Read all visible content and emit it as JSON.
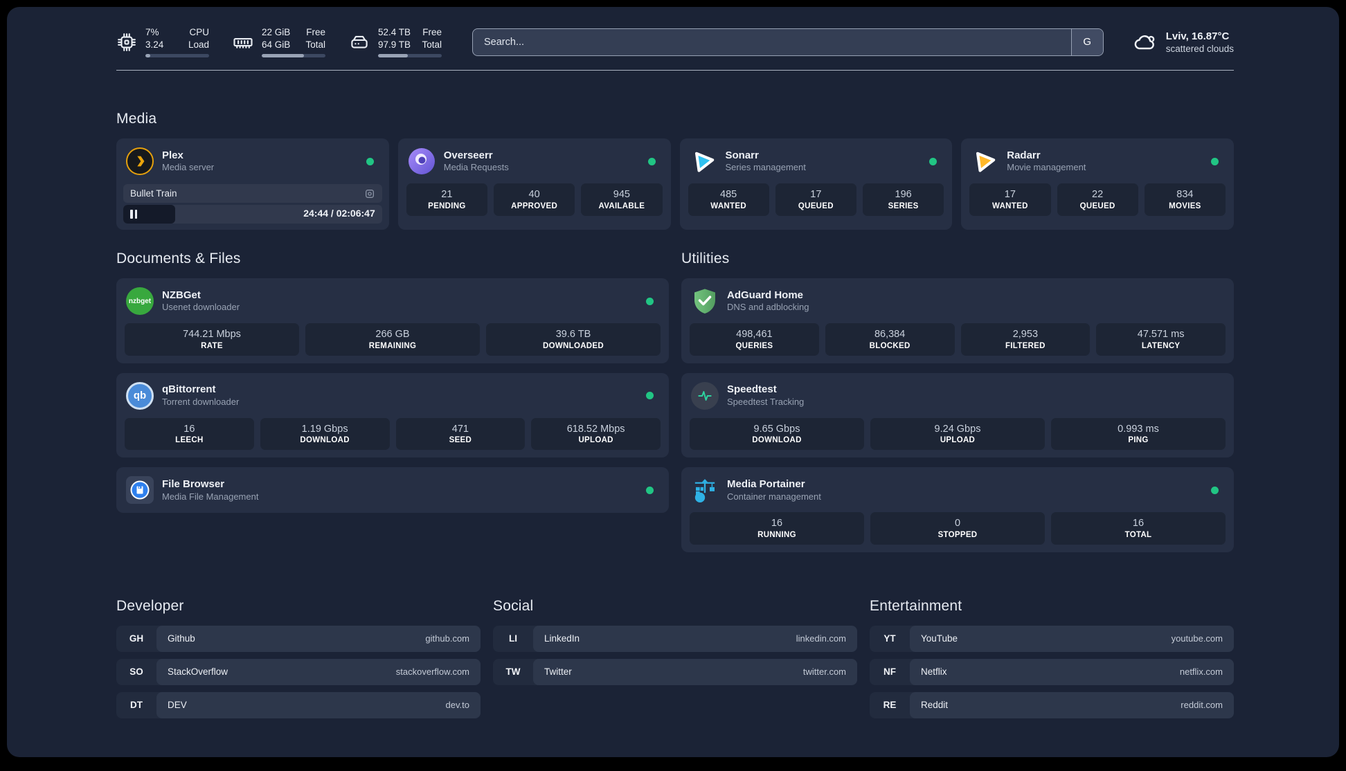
{
  "header": {
    "widgets": [
      {
        "name": "cpu",
        "value_top": "7%",
        "value_bottom": "3.24",
        "label_top": "CPU",
        "label_bottom": "Load",
        "progress_pct": 8
      },
      {
        "name": "memory",
        "value_top": "22 GiB",
        "value_bottom": "64 GiB",
        "label_top": "Free",
        "label_bottom": "Total",
        "progress_pct": 66
      },
      {
        "name": "disk",
        "value_top": "52.4 TB",
        "value_bottom": "97.9 TB",
        "label_top": "Free",
        "label_bottom": "Total",
        "progress_pct": 47
      }
    ],
    "search": {
      "placeholder": "Search...",
      "button_label": "G"
    },
    "weather": {
      "title": "Lviv, 16.87°C",
      "subtitle": "scattered clouds"
    }
  },
  "sections": {
    "media": {
      "title": "Media",
      "services": [
        {
          "name": "Plex",
          "description": "Media server",
          "status": "online",
          "player": {
            "track": "Bullet Train",
            "time": "24:44 / 02:06:47",
            "progress_pct": 20
          }
        },
        {
          "name": "Overseerr",
          "description": "Media Requests",
          "status": "online",
          "stats": [
            {
              "value": "21",
              "label": "PENDING"
            },
            {
              "value": "40",
              "label": "APPROVED"
            },
            {
              "value": "945",
              "label": "AVAILABLE"
            }
          ]
        },
        {
          "name": "Sonarr",
          "description": "Series management",
          "status": "online",
          "stats": [
            {
              "value": "485",
              "label": "WANTED"
            },
            {
              "value": "17",
              "label": "QUEUED"
            },
            {
              "value": "196",
              "label": "SERIES"
            }
          ]
        },
        {
          "name": "Radarr",
          "description": "Movie management",
          "status": "online",
          "stats": [
            {
              "value": "17",
              "label": "WANTED"
            },
            {
              "value": "22",
              "label": "QUEUED"
            },
            {
              "value": "834",
              "label": "MOVIES"
            }
          ]
        }
      ]
    },
    "documents": {
      "title": "Documents & Files",
      "services": [
        {
          "name": "NZBGet",
          "description": "Usenet downloader",
          "status": "online",
          "stats": [
            {
              "value": "744.21 Mbps",
              "label": "RATE"
            },
            {
              "value": "266 GB",
              "label": "REMAINING"
            },
            {
              "value": "39.6 TB",
              "label": "DOWNLOADED"
            }
          ]
        },
        {
          "name": "qBittorrent",
          "description": "Torrent downloader",
          "status": "online",
          "stats": [
            {
              "value": "16",
              "label": "LEECH"
            },
            {
              "value": "1.19 Gbps",
              "label": "DOWNLOAD"
            },
            {
              "value": "471",
              "label": "SEED"
            },
            {
              "value": "618.52 Mbps",
              "label": "UPLOAD"
            }
          ]
        },
        {
          "name": "File Browser",
          "description": "Media File Management",
          "status": "online"
        }
      ]
    },
    "utilities": {
      "title": "Utilities",
      "services": [
        {
          "name": "AdGuard Home",
          "description": "DNS and adblocking",
          "stats": [
            {
              "value": "498,461",
              "label": "QUERIES"
            },
            {
              "value": "86,384",
              "label": "BLOCKED"
            },
            {
              "value": "2,953",
              "label": "FILTERED"
            },
            {
              "value": "47.571 ms",
              "label": "LATENCY"
            }
          ]
        },
        {
          "name": "Speedtest",
          "description": "Speedtest Tracking",
          "stats": [
            {
              "value": "9.65 Gbps",
              "label": "DOWNLOAD"
            },
            {
              "value": "9.24 Gbps",
              "label": "UPLOAD"
            },
            {
              "value": "0.993 ms",
              "label": "PING"
            }
          ]
        },
        {
          "name": "Media Portainer",
          "description": "Container management",
          "status": "online",
          "stats": [
            {
              "value": "16",
              "label": "RUNNING"
            },
            {
              "value": "0",
              "label": "STOPPED"
            },
            {
              "value": "16",
              "label": "TOTAL"
            }
          ]
        }
      ]
    },
    "bookmarks": [
      {
        "title": "Developer",
        "links": [
          {
            "abbr": "GH",
            "name": "Github",
            "url": "github.com"
          },
          {
            "abbr": "SO",
            "name": "StackOverflow",
            "url": "stackoverflow.com"
          },
          {
            "abbr": "DT",
            "name": "DEV",
            "url": "dev.to"
          }
        ]
      },
      {
        "title": "Social",
        "links": [
          {
            "abbr": "LI",
            "name": "LinkedIn",
            "url": "linkedin.com"
          },
          {
            "abbr": "TW",
            "name": "Twitter",
            "url": "twitter.com"
          }
        ]
      },
      {
        "title": "Entertainment",
        "links": [
          {
            "abbr": "YT",
            "name": "YouTube",
            "url": "youtube.com"
          },
          {
            "abbr": "NF",
            "name": "Netflix",
            "url": "netflix.com"
          },
          {
            "abbr": "RE",
            "name": "Reddit",
            "url": "reddit.com"
          }
        ]
      }
    ]
  },
  "colors": {
    "status_online": "#21c584",
    "page_bg": "#1b2336",
    "card_bg": "#262f44",
    "stat_bg": "#1d2535"
  }
}
